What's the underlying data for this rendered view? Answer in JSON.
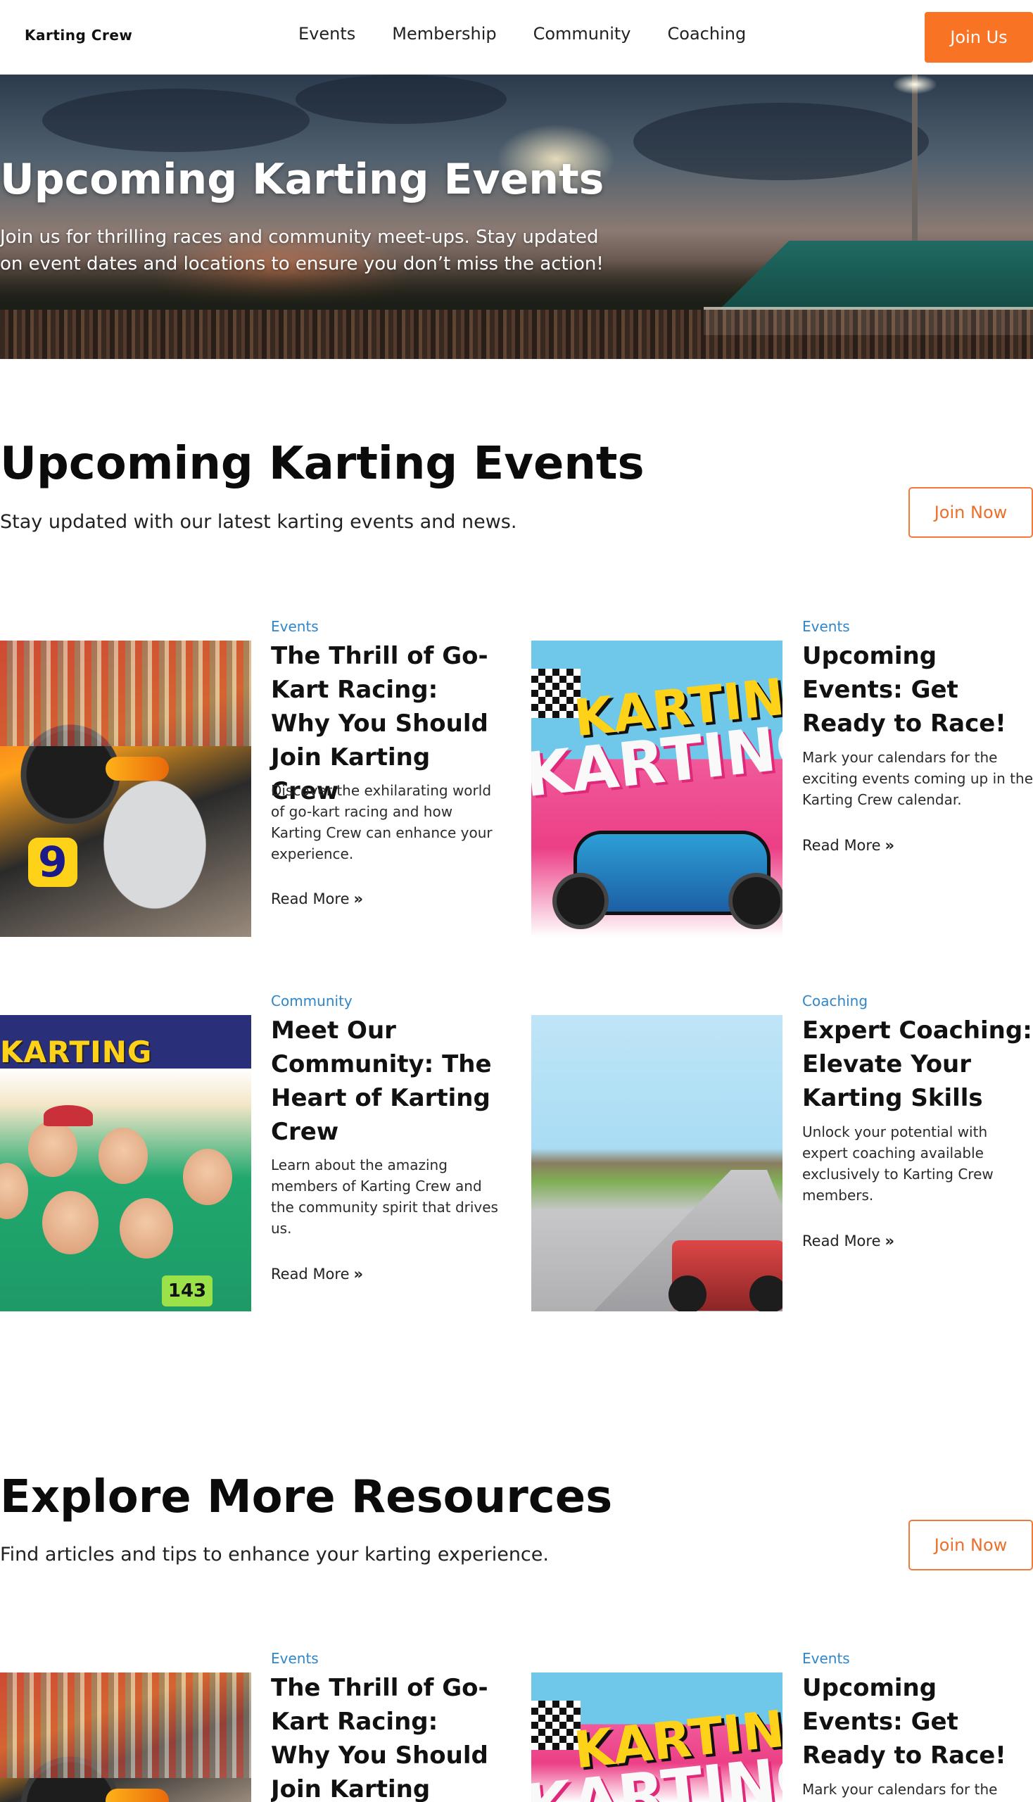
{
  "nav": {
    "logo": "Karting Crew",
    "links": [
      "Events",
      "Membership",
      "Community",
      "Coaching"
    ],
    "cta": "Join Us"
  },
  "hero": {
    "title": "Upcoming Karting Events",
    "subtitle": "Join us for thrilling races and community meet-ups. Stay updated on event dates and locations to ensure you don’t miss the action!"
  },
  "events_section": {
    "title": "Upcoming Karting Events",
    "subtitle": "Stay updated with our latest karting events and news.",
    "button": "Join Now",
    "cards": [
      {
        "category": "Events",
        "title": "The Thrill of Go-Kart Racing: Why You Should Join Karting Crew",
        "description": "Discover the exhilarating world of go-kart racing and how Karting Crew can enhance your experience.",
        "link": "Read More",
        "image": "kart-racer-number-9"
      },
      {
        "category": "Events",
        "title": "Upcoming Events: Get Ready to Race!",
        "description": "Mark your calendars for the exciting events coming up in the Karting Crew calendar.",
        "link": "Read More",
        "image": "karting-pop-art"
      },
      {
        "category": "Community",
        "title": "Meet Our Community: The Heart of Karting Crew",
        "description": "Learn about the amazing members of Karting Crew and the community spirit that drives us.",
        "link": "Read More",
        "image": "karting-community-group"
      },
      {
        "category": "Coaching",
        "title": "Expert Coaching: Elevate Your Karting Skills",
        "description": "Unlock your potential with expert coaching available exclusively to Karting Crew members.",
        "link": "Read More",
        "image": "kart-on-track"
      }
    ]
  },
  "resources_section": {
    "title": "Explore More Resources",
    "subtitle": "Find articles and tips to enhance your karting experience.",
    "button": "Join Now",
    "cards": [
      {
        "category": "Events",
        "title": "The Thrill of Go-Kart Racing: Why You Should Join Karting Crew",
        "image": "kart-racer-number-9"
      },
      {
        "category": "Events",
        "title": "Upcoming Events: Get Ready to Race!",
        "description": "Mark your calendars for the",
        "image": "karting-pop-art"
      }
    ]
  },
  "image_text": {
    "kart_number": "9",
    "pop_art_word": "KARTING",
    "banner_word": "KARTING",
    "plate_number": "143"
  },
  "colors": {
    "accent_orange": "#f97324",
    "category_blue": "#2f86c9"
  },
  "icons": {
    "read_more": "double-chevron-right-icon"
  }
}
